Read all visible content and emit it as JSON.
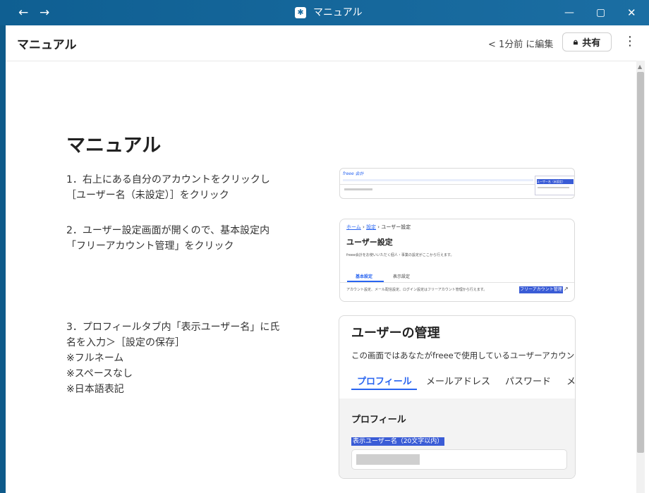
{
  "window": {
    "title": "マニュアル",
    "back_icon": "arrow-left",
    "forward_icon": "arrow-right"
  },
  "appbar": {
    "title": "マニュアル",
    "edited": "< 1分前 に編集",
    "share_label": "共有"
  },
  "doc": {
    "heading": "マニュアル",
    "step1": {
      "line1": "1．右上にある自分のアカウントをクリックし",
      "line2": "［ユーザー名（未設定）］をクリック"
    },
    "step2": {
      "line1": "2．ユーザー設定画面が開くので、基本設定内",
      "line2": "「フリーアカウント管理」をクリック"
    },
    "step3": {
      "line1": "3．プロフィールタブ内「表示ユーザー名」に氏",
      "line2": "名を入力＞［設定の保存］",
      "line3": "※フルネーム",
      "line4": "※スペースなし",
      "line5": "※日本語表記"
    }
  },
  "shot1": {
    "logo": "freee 会計",
    "menu_item": "ユーザー名（未設定）"
  },
  "shot2": {
    "bc_home": "ホーム",
    "bc_settings": "設定",
    "bc_current": "ユーザー設定",
    "title": "ユーザー設定",
    "desc": "freee会計をお使いいただく個人・事業の設定がここから行えます。",
    "tab_basic": "基本設定",
    "tab_display": "表示設定",
    "body": "アカウント設定、メール配信設定、ログイン設定はフリーアカウント管理から行えます。",
    "link": "フリーアカウント管理"
  },
  "shot3": {
    "title": "ユーザーの管理",
    "desc": "この画面ではあなたがfreeeで使用しているユーザーアカウント",
    "tabs": [
      "プロフィール",
      "メールアドレス",
      "パスワード",
      "メ"
    ],
    "section": "プロフィール",
    "field_label": "表示ユーザー名（20文字以内）"
  },
  "colors": {
    "titlebar": "#1b6ea3",
    "accent": "#2864f0",
    "highlight": "#3a5cd6"
  }
}
